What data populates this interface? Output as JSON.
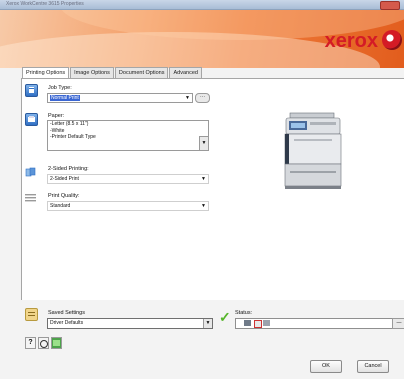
{
  "window": {
    "title": "Xerox WorkCentre 3615 Properties"
  },
  "banner": {
    "brand": "xerox"
  },
  "tabs": [
    {
      "label": "Printing Options",
      "active": true
    },
    {
      "label": "Image Options",
      "active": false
    },
    {
      "label": "Document Options",
      "active": false
    },
    {
      "label": "Advanced",
      "active": false
    }
  ],
  "job_type": {
    "label": "Job Type:",
    "value": "Normal Print"
  },
  "paper": {
    "label": "Paper:",
    "lines": [
      "-Letter (8.5 x 11\")",
      "-White",
      "-Printer Default Type"
    ]
  },
  "two_sided": {
    "label": "2-Sided Printing:",
    "value": "2-Sided Print"
  },
  "print_quality": {
    "label": "Print Quality:",
    "value": "Standard"
  },
  "saved_settings": {
    "label": "Saved Settings",
    "value": "Driver Defaults"
  },
  "status": {
    "label": "Status:"
  },
  "buttons": {
    "ok": "OK",
    "cancel": "Cancel",
    "help": "?"
  },
  "colors": {
    "accent_blue": "#3b67d3",
    "brand_red": "#d41b26",
    "banner_orange": "#ee7b3a"
  }
}
